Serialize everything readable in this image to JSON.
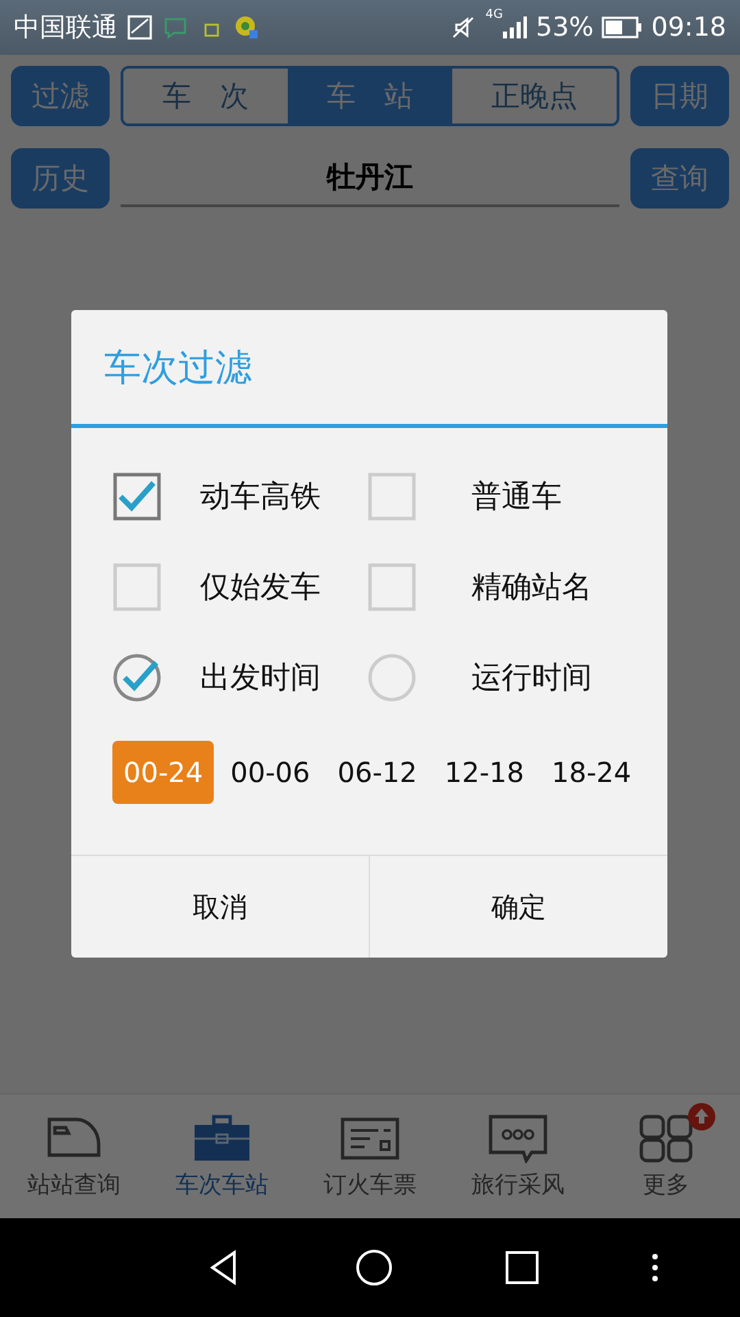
{
  "status_bar": {
    "carrier": "中国联通",
    "network": "4G",
    "battery": "53%",
    "time": "09:18"
  },
  "toolbar": {
    "left_button": "过滤",
    "segments": [
      {
        "label": "车　次",
        "selected": false
      },
      {
        "label": "车　站",
        "selected": true
      },
      {
        "label": "正晚点",
        "selected": false
      }
    ],
    "right_button": "日期"
  },
  "search_row": {
    "left_button": "历史",
    "station": "牡丹江",
    "right_button": "查询"
  },
  "dialog": {
    "title": "车次过滤",
    "options": [
      {
        "label": "动车高铁",
        "kind": "checkbox",
        "checked": true
      },
      {
        "label": "普通车",
        "kind": "checkbox",
        "checked": false
      },
      {
        "label": "仅始发车",
        "kind": "checkbox",
        "checked": false
      },
      {
        "label": "精确站名",
        "kind": "checkbox",
        "checked": false
      },
      {
        "label": "出发时间",
        "kind": "radio",
        "checked": true
      },
      {
        "label": "运行时间",
        "kind": "radio",
        "checked": false
      }
    ],
    "time_ranges": [
      {
        "label": "00-24",
        "selected": true
      },
      {
        "label": "00-06",
        "selected": false
      },
      {
        "label": "06-12",
        "selected": false
      },
      {
        "label": "12-18",
        "selected": false
      },
      {
        "label": "18-24",
        "selected": false
      }
    ],
    "buttons": [
      "取消",
      "确定"
    ]
  },
  "bottom_nav": [
    {
      "label": "站站查询",
      "selected": false,
      "badge": false
    },
    {
      "label": "车次车站",
      "selected": true,
      "badge": false
    },
    {
      "label": "订火车票",
      "selected": false,
      "badge": false
    },
    {
      "label": "旅行采风",
      "selected": false,
      "badge": false
    },
    {
      "label": "更多",
      "selected": false,
      "badge": true
    }
  ]
}
